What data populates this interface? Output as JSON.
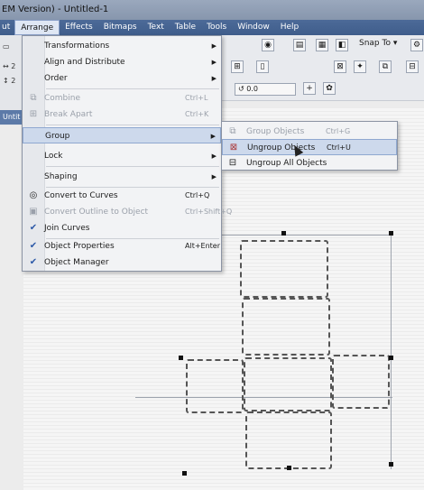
{
  "window": {
    "title": "EM Version) - Untitled-1"
  },
  "menubar": {
    "items": [
      {
        "label": "ut",
        "active": false
      },
      {
        "label": "Arrange",
        "active": true
      },
      {
        "label": "Effects",
        "active": false
      },
      {
        "label": "Bitmaps",
        "active": false
      },
      {
        "label": "Text",
        "active": false
      },
      {
        "label": "Table",
        "active": false
      },
      {
        "label": "Tools",
        "active": false
      },
      {
        "label": "Window",
        "active": false
      },
      {
        "label": "Help",
        "active": false
      }
    ]
  },
  "arrange_menu": {
    "items": [
      {
        "label": "Transformations",
        "shortcut": "",
        "submenu": true,
        "disabled": false,
        "icon": ""
      },
      {
        "label": "Align and Distribute",
        "shortcut": "",
        "submenu": true,
        "disabled": false,
        "icon": ""
      },
      {
        "label": "Order",
        "shortcut": "",
        "submenu": true,
        "disabled": false,
        "icon": ""
      },
      {
        "label": "Combine",
        "shortcut": "Ctrl+L",
        "submenu": false,
        "disabled": true,
        "icon": "combine-icon"
      },
      {
        "label": "Break Apart",
        "shortcut": "Ctrl+K",
        "submenu": false,
        "disabled": true,
        "icon": "break-apart-icon"
      },
      {
        "label": "Group",
        "shortcut": "",
        "submenu": true,
        "disabled": false,
        "icon": "",
        "highlighted": true
      },
      {
        "label": "Lock",
        "shortcut": "",
        "submenu": true,
        "disabled": false,
        "icon": ""
      },
      {
        "label": "Shaping",
        "shortcut": "",
        "submenu": true,
        "disabled": false,
        "icon": ""
      },
      {
        "label": "Convert to Curves",
        "shortcut": "Ctrl+Q",
        "submenu": false,
        "disabled": false,
        "icon": "convert-to-curves-icon"
      },
      {
        "label": "Convert Outline to Object",
        "shortcut": "Ctrl+Shift+Q",
        "submenu": false,
        "disabled": true,
        "icon": "convert-outline-icon"
      },
      {
        "label": "Join Curves",
        "shortcut": "",
        "submenu": false,
        "disabled": false,
        "icon": "checkmark-icon"
      },
      {
        "label": "Object Properties",
        "shortcut": "Alt+Enter",
        "submenu": false,
        "disabled": false,
        "icon": "checkmark-icon"
      },
      {
        "label": "Object Manager",
        "shortcut": "",
        "submenu": false,
        "disabled": false,
        "icon": "checkmark-icon"
      }
    ]
  },
  "group_submenu": {
    "items": [
      {
        "label": "Group Objects",
        "shortcut": "Ctrl+G",
        "disabled": true,
        "icon": "group-objects-icon"
      },
      {
        "label": "Ungroup Objects",
        "shortcut": "Ctrl+U",
        "disabled": false,
        "highlighted": true,
        "icon": "ungroup-objects-icon"
      },
      {
        "label": "Ungroup All Objects",
        "shortcut": "",
        "disabled": false,
        "icon": "ungroup-all-icon"
      }
    ]
  },
  "toolbar": {
    "snap_to_label": "Snap To",
    "rotation_value": "0.0",
    "left_values": [
      "2",
      "2"
    ],
    "doc_tab_label": "Untit"
  },
  "colors": {
    "menubar": "#4c6a98",
    "highlight": "#cdd9ec",
    "canvas": "#f5f5f5"
  }
}
